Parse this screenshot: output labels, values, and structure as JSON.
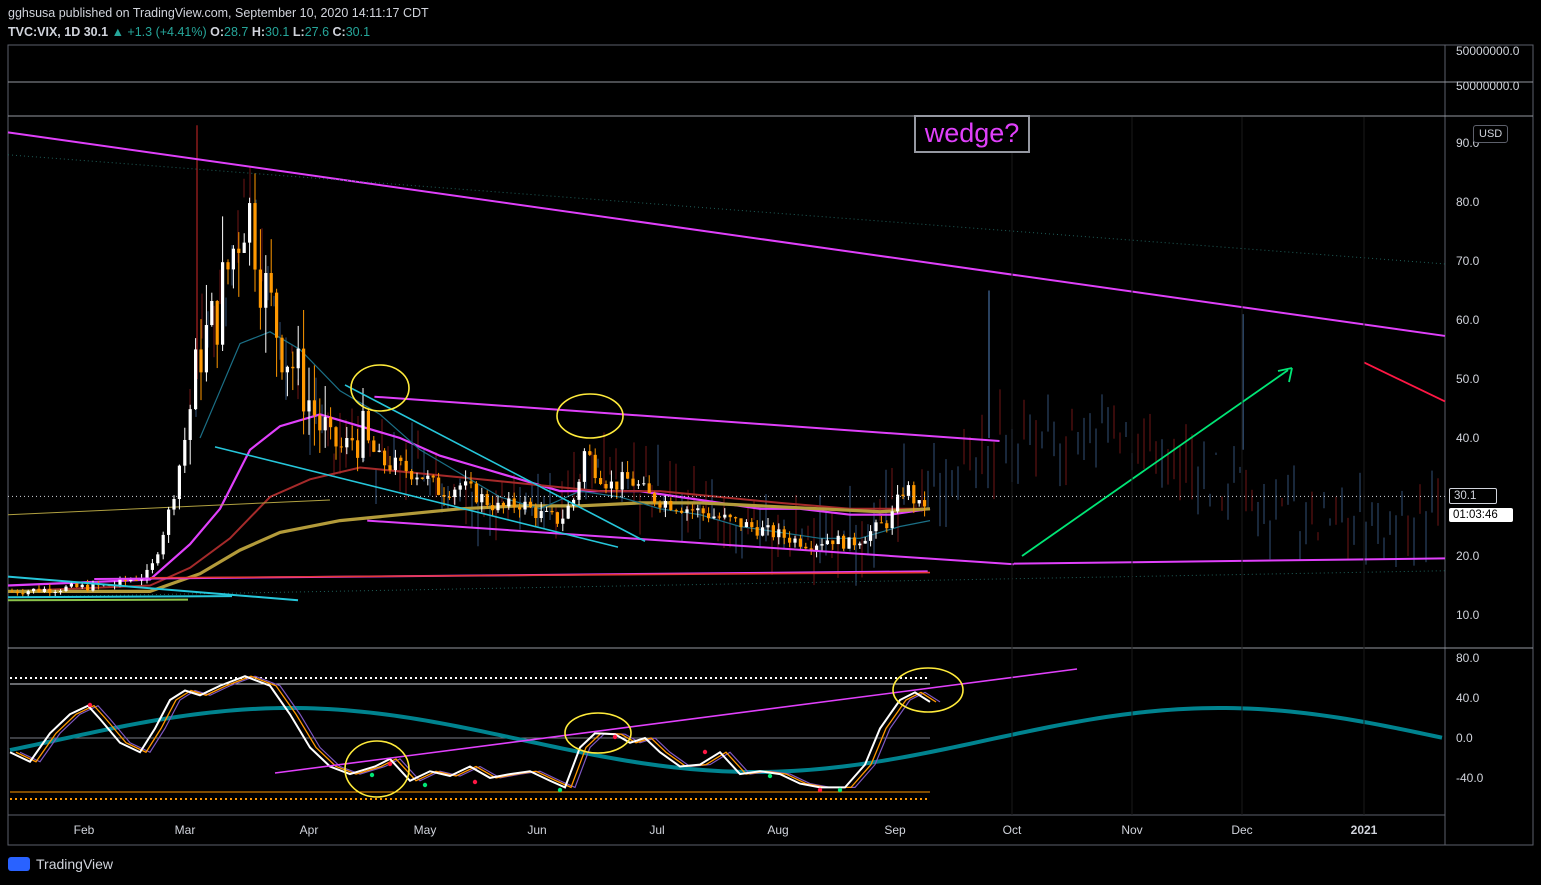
{
  "header": {
    "published": "gghsusa published on TradingView.com, September 10, 2020 14:11:17 CDT",
    "symbol": "TVC:VIX, 1D",
    "last": "30.1",
    "change": "+1.3 (+4.41%)",
    "o_label": "O:",
    "o": "28.7",
    "h_label": "H:",
    "h": "30.1",
    "l_label": "L:",
    "l": "27.6",
    "c_label": "C:",
    "c": "30.1"
  },
  "annotation": {
    "text": "wedge?"
  },
  "tags": {
    "price": "30.1",
    "timer": "01:03:46",
    "currency": "USD"
  },
  "brand": {
    "name": "TradingView"
  },
  "colors": {
    "background": "#000000",
    "pane_border": "#5d606b",
    "up": "#ffffff",
    "down": "#ff9800",
    "projection": "#29415f",
    "projection_down": "#5a1212",
    "magenta": "#e040fb",
    "cyan": "#26c6da",
    "yellow": "#ffeb3b",
    "green": "#00e676",
    "red": "#ff1744",
    "teal": "#00838f",
    "sma_gold": "#b39b3a"
  },
  "chart_data": [
    {
      "type": "candlestick",
      "title": "",
      "x_ticks": [
        "Feb",
        "Mar",
        "Apr",
        "May",
        "Jun",
        "Jul",
        "Aug",
        "Sep",
        "Oct",
        "Nov",
        "Dec",
        "2021"
      ],
      "y_ticks": [
        10,
        20,
        30,
        40,
        50,
        60,
        70,
        80,
        90
      ],
      "y_top_ticks": [
        "50000000.0",
        "50000000.0"
      ],
      "ylim": [
        3,
        96
      ],
      "currency": "USD",
      "grid": false,
      "last_close": 30.1,
      "series_ohlc_monthly_approx": [
        {
          "month": "Feb",
          "low": 12,
          "high": 18
        },
        {
          "month": "Mar",
          "low": 20,
          "high": 85
        },
        {
          "month": "Apr",
          "low": 31,
          "high": 57
        },
        {
          "month": "May",
          "low": 27,
          "high": 38
        },
        {
          "month": "Jun",
          "low": 25,
          "high": 44
        },
        {
          "month": "Jul",
          "low": 24,
          "high": 35
        },
        {
          "month": "Aug",
          "low": 21,
          "high": 29
        },
        {
          "month": "Sep",
          "low": 25,
          "high": 38
        }
      ],
      "trendlines": [
        {
          "from": [
            0.0,
            91.8
          ],
          "to": [
            1.0,
            57.3
          ],
          "color": "magenta"
        },
        {
          "from": [
            0.255,
            47.0
          ],
          "to": [
            0.69,
            39.5
          ],
          "color": "magenta"
        },
        {
          "from": [
            0.25,
            26.0
          ],
          "to": [
            0.7,
            18.6
          ],
          "color": "magenta"
        },
        {
          "from": [
            0.7,
            18.7
          ],
          "to": [
            1.0,
            19.6
          ],
          "color": "magenta"
        },
        {
          "from": [
            0.06,
            16.1
          ],
          "to": [
            0.64,
            17.4
          ],
          "color": "magenta"
        }
      ]
    },
    {
      "type": "line",
      "title": "",
      "y_ticks": [
        -40,
        0,
        40,
        80
      ],
      "ylim": [
        -85,
        87
      ],
      "grid": false
    }
  ]
}
